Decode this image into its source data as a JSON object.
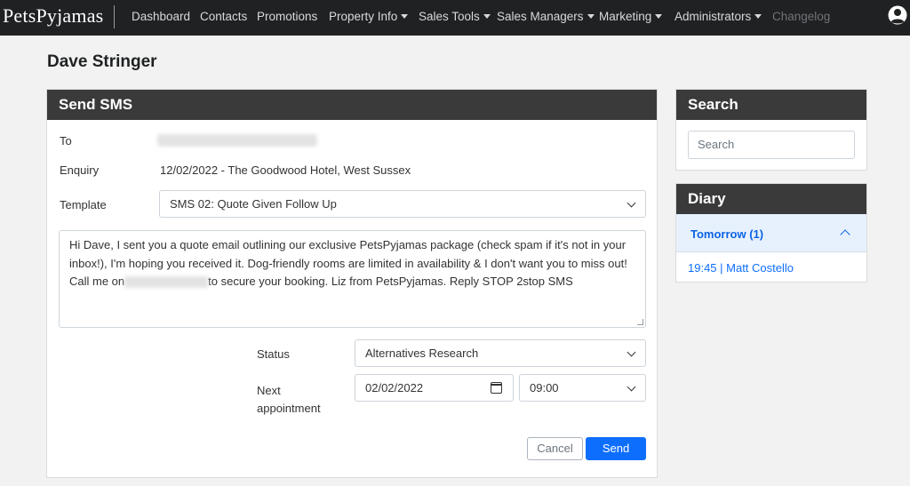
{
  "nav": {
    "brand": "PetsPyjamas",
    "items": [
      {
        "label": "Dashboard",
        "dropdown": false
      },
      {
        "label": "Contacts",
        "dropdown": false
      },
      {
        "label": "Promotions",
        "dropdown": false
      },
      {
        "label": "Property Info",
        "dropdown": true
      },
      {
        "label": "Sales Tools",
        "dropdown": true
      },
      {
        "label": "Sales Managers",
        "dropdown": true
      },
      {
        "label": "Marketing",
        "dropdown": true
      },
      {
        "label": "Administrators",
        "dropdown": true
      },
      {
        "label": "Changelog",
        "dropdown": false,
        "muted": true
      }
    ],
    "user_icon": "user-circle-icon"
  },
  "page": {
    "title": "Dave Stringer"
  },
  "sms": {
    "header": "Send SMS",
    "to_label": "To",
    "enquiry_label": "Enquiry",
    "enquiry_value": "12/02/2022 - The Goodwood Hotel, West Sussex",
    "template_label": "Template",
    "template_value": "SMS 02: Quote Given Follow Up",
    "message_before": "Hi Dave, I sent you a quote email outlining our exclusive PetsPyjamas package (check spam if it's not in your inbox!), I'm hoping you received it. Dog-friendly rooms are limited in availability & I don't want you to miss out! Call me on",
    "message_after": "to secure your booking. Liz from PetsPyjamas. Reply STOP 2stop SMS",
    "status_label": "Status",
    "status_value": "Alternatives Research",
    "next_appt_label_1": "Next",
    "next_appt_label_2": "appointment",
    "date_value": "02/02/2022",
    "time_value": "09:00",
    "cancel_label": "Cancel",
    "send_label": "Send"
  },
  "search": {
    "header": "Search",
    "placeholder": "Search"
  },
  "diary": {
    "header": "Diary",
    "group_label": "Tomorrow (1)",
    "entries": [
      "19:45 | Matt Costello"
    ]
  },
  "colors": {
    "navbar_bg": "#1f2123",
    "card_header_bg": "#3a3a3a",
    "primary": "#0d6efd",
    "accordion_bg": "#e7f1fd"
  }
}
